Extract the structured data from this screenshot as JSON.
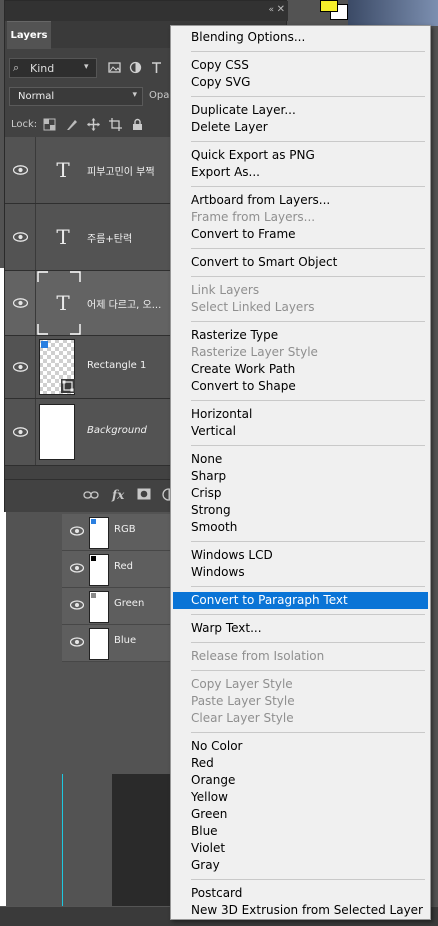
{
  "layers_panel": {
    "tab_label": "Layers",
    "filter_kind": "Kind",
    "blend_mode": "Normal",
    "opacity_label": "Opac",
    "lock_label": "Lock:",
    "layers": [
      {
        "name": "피부고민이 부쩍",
        "type": "text",
        "visible": true,
        "selected": false
      },
      {
        "name": "주름+탄력",
        "type": "text",
        "visible": true,
        "selected": false
      },
      {
        "name": "어제 다르고, 오...",
        "type": "text",
        "visible": true,
        "selected": true
      },
      {
        "name": "Rectangle 1",
        "type": "shape",
        "visible": true,
        "selected": false
      },
      {
        "name": "Background",
        "type": "background",
        "visible": true,
        "selected": false
      }
    ],
    "footer_icons": [
      "link-icon",
      "fx-icon",
      "mask-icon",
      "adjustment-icon"
    ],
    "fx_label": "fx"
  },
  "channels_panel": {
    "channels": [
      {
        "name": "RGB",
        "dot_color": "#2a7fe0"
      },
      {
        "name": "Red",
        "dot_color": "#000000"
      },
      {
        "name": "Green",
        "dot_color": "#8a8a8a"
      },
      {
        "name": "Blue",
        "dot_color": "#2a7fe0"
      }
    ]
  },
  "context_menu": {
    "items": [
      {
        "label": "Blending Options...",
        "enabled": true
      },
      {
        "sep": true
      },
      {
        "label": "Copy CSS",
        "enabled": true
      },
      {
        "label": "Copy SVG",
        "enabled": true
      },
      {
        "sep": true
      },
      {
        "label": "Duplicate Layer...",
        "enabled": true
      },
      {
        "label": "Delete Layer",
        "enabled": true
      },
      {
        "sep": true
      },
      {
        "label": "Quick Export as PNG",
        "enabled": true
      },
      {
        "label": "Export As...",
        "enabled": true
      },
      {
        "sep": true
      },
      {
        "label": "Artboard from Layers...",
        "enabled": true
      },
      {
        "label": "Frame from Layers...",
        "enabled": false
      },
      {
        "label": "Convert to Frame",
        "enabled": true
      },
      {
        "sep": true
      },
      {
        "label": "Convert to Smart Object",
        "enabled": true
      },
      {
        "sep": true
      },
      {
        "label": "Link Layers",
        "enabled": false
      },
      {
        "label": "Select Linked Layers",
        "enabled": false
      },
      {
        "sep": true
      },
      {
        "label": "Rasterize Type",
        "enabled": true
      },
      {
        "label": "Rasterize Layer Style",
        "enabled": false
      },
      {
        "label": "Create Work Path",
        "enabled": true
      },
      {
        "label": "Convert to Shape",
        "enabled": true
      },
      {
        "sep": true
      },
      {
        "label": "Horizontal",
        "enabled": true
      },
      {
        "label": "Vertical",
        "enabled": true
      },
      {
        "sep": true
      },
      {
        "label": "None",
        "enabled": true
      },
      {
        "label": "Sharp",
        "enabled": true
      },
      {
        "label": "Crisp",
        "enabled": true
      },
      {
        "label": "Strong",
        "enabled": true
      },
      {
        "label": "Smooth",
        "enabled": true
      },
      {
        "sep": true
      },
      {
        "label": "Windows LCD",
        "enabled": true
      },
      {
        "label": "Windows",
        "enabled": true
      },
      {
        "sep": true
      },
      {
        "label": "Convert to Paragraph Text",
        "enabled": true,
        "highlighted": true
      },
      {
        "sep": true
      },
      {
        "label": "Warp Text...",
        "enabled": true
      },
      {
        "sep": true
      },
      {
        "label": "Release from Isolation",
        "enabled": false
      },
      {
        "sep": true
      },
      {
        "label": "Copy Layer Style",
        "enabled": false
      },
      {
        "label": "Paste Layer Style",
        "enabled": false
      },
      {
        "label": "Clear Layer Style",
        "enabled": false
      },
      {
        "sep": true
      },
      {
        "label": "No Color",
        "enabled": true
      },
      {
        "label": "Red",
        "enabled": true
      },
      {
        "label": "Orange",
        "enabled": true
      },
      {
        "label": "Yellow",
        "enabled": true
      },
      {
        "label": "Green",
        "enabled": true
      },
      {
        "label": "Blue",
        "enabled": true
      },
      {
        "label": "Violet",
        "enabled": true
      },
      {
        "label": "Gray",
        "enabled": true
      },
      {
        "sep": true
      },
      {
        "label": "Postcard",
        "enabled": true
      },
      {
        "label": "New 3D Extrusion from Selected Layer",
        "enabled": true
      }
    ]
  },
  "colors": {
    "menu_highlight": "#0a74d6",
    "guide": "#1ec8e0",
    "foreground_swatch": "#f6ef2a",
    "background_swatch": "#ffffff"
  }
}
